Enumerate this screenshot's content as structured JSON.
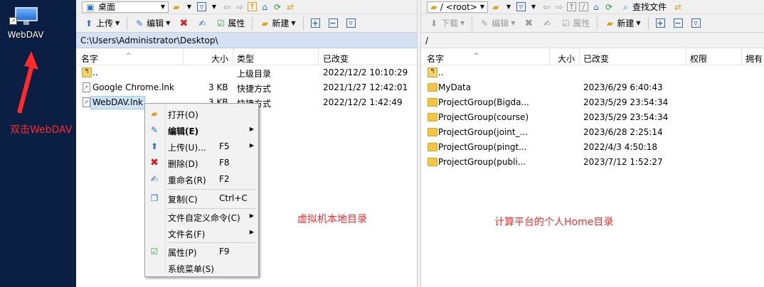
{
  "desktop": {
    "icon_label": "WebDAV",
    "annotation": "双击WebDAV"
  },
  "left_panel": {
    "address": "桌面",
    "toolbar": {
      "upload": "上传",
      "edit": "编辑",
      "properties": "属性",
      "new": "新建"
    },
    "path": "C:\\Users\\Administrator\\Desktop\\",
    "columns": {
      "name": "名字",
      "size": "大小",
      "type": "类型",
      "modified": "已改变"
    },
    "rows": [
      {
        "name": "..",
        "size": "",
        "type": "上级目录",
        "modified": "2022/12/2  10:10:29"
      },
      {
        "name": "Google Chrome.lnk",
        "size": "3 KB",
        "type": "快捷方式",
        "modified": "2021/1/27  12:42:01"
      },
      {
        "name": "WebDAV.lnk",
        "size": "3 KB",
        "type": "快捷方式",
        "modified": "2022/12/2  1:42:49"
      }
    ],
    "annotation": "虚拟机本地目录"
  },
  "context_menu": {
    "items": [
      {
        "label": "打开(O)",
        "shortcut": "",
        "submenu": false,
        "bold": false,
        "icon": "folder-open-icon"
      },
      {
        "label": "编辑(E)",
        "shortcut": "",
        "submenu": true,
        "bold": true,
        "icon": "edit-icon"
      },
      {
        "label": "上传(U)...",
        "shortcut": "F5",
        "submenu": true,
        "bold": false,
        "icon": "upload-icon"
      },
      {
        "label": "删除(D)",
        "shortcut": "F8",
        "submenu": false,
        "bold": false,
        "icon": "delete-icon"
      },
      {
        "label": "重命名(R)",
        "shortcut": "F2",
        "submenu": false,
        "bold": false,
        "icon": "rename-icon"
      },
      {
        "label": "复制(C)",
        "shortcut": "Ctrl+C",
        "submenu": false,
        "bold": false,
        "icon": "copy-icon"
      },
      {
        "label": "文件自定义命令(C)",
        "shortcut": "",
        "submenu": true,
        "bold": false,
        "icon": ""
      },
      {
        "label": "文件名(F)",
        "shortcut": "",
        "submenu": true,
        "bold": false,
        "icon": ""
      },
      {
        "label": "属性(P)",
        "shortcut": "F9",
        "submenu": false,
        "bold": false,
        "icon": "properties-icon"
      },
      {
        "label": "系统菜单(S)",
        "shortcut": "",
        "submenu": false,
        "bold": false,
        "icon": ""
      }
    ]
  },
  "right_panel": {
    "address": "/ <root>",
    "find_files": "查找文件",
    "toolbar": {
      "download": "下载",
      "edit": "编辑",
      "properties": "属性",
      "new": "新建"
    },
    "path": "/",
    "columns": {
      "name": "名字",
      "size": "大小",
      "modified": "已改变",
      "permissions": "权限",
      "owner": "拥有"
    },
    "rows": [
      {
        "name": "..",
        "modified": ""
      },
      {
        "name": "MyData",
        "modified": "2023/6/29 6:40:43"
      },
      {
        "name": "ProjectGroup(Bigda...",
        "modified": "2023/5/29 23:54:34"
      },
      {
        "name": "ProjectGroup(course)",
        "modified": "2023/5/29 23:54:34"
      },
      {
        "name": "ProjectGroup(joint_...",
        "modified": "2023/6/28 2:25:14"
      },
      {
        "name": "ProjectGroup(pingt...",
        "modified": "2022/4/3 4:50:18"
      },
      {
        "name": "ProjectGroup(publi...",
        "modified": "2023/7/12 1:52:27"
      }
    ],
    "annotation": "计算平台的个人Home目录"
  }
}
